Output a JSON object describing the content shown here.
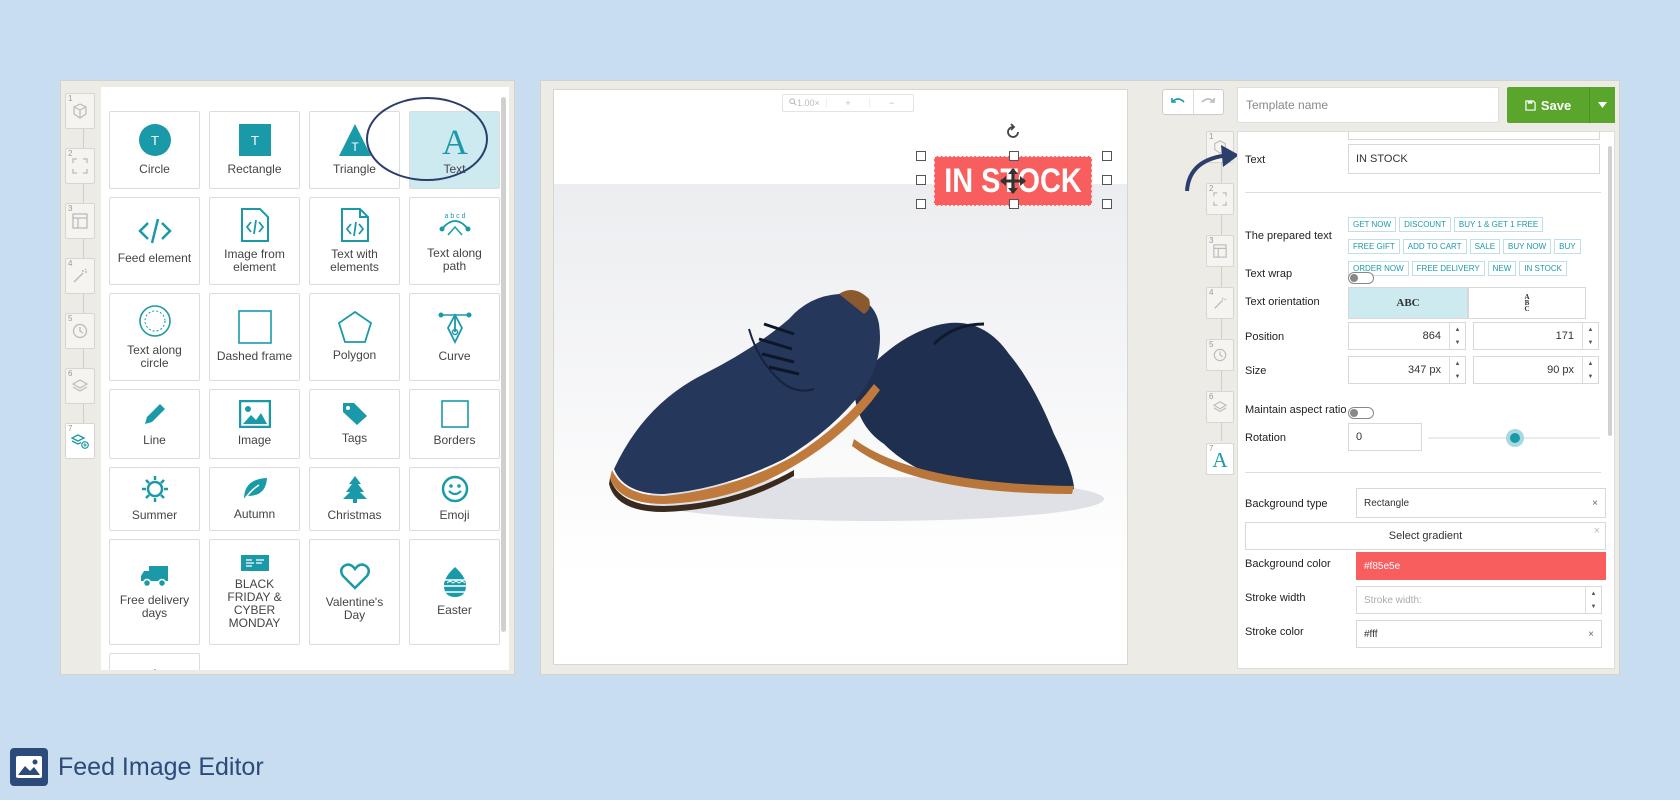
{
  "brand": {
    "title": "Feed Image Editor"
  },
  "elements": [
    {
      "label": "Circle",
      "icon": "circle-icon"
    },
    {
      "label": "Rectangle",
      "icon": "rectangle-icon"
    },
    {
      "label": "Triangle",
      "icon": "triangle-icon"
    },
    {
      "label": "Text",
      "icon": "text-icon"
    },
    {
      "label": "Feed element",
      "icon": "code-icon"
    },
    {
      "label": "Image from element",
      "icon": "image-code-icon"
    },
    {
      "label": "Text with elements",
      "icon": "file-code-icon"
    },
    {
      "label": "Text along path",
      "icon": "text-path-icon"
    },
    {
      "label": "Text along circle",
      "icon": "text-circle-icon"
    },
    {
      "label": "Dashed frame",
      "icon": "frame-icon"
    },
    {
      "label": "Polygon",
      "icon": "polygon-icon"
    },
    {
      "label": "Curve",
      "icon": "curve-icon"
    },
    {
      "label": "Line",
      "icon": "pencil-icon"
    },
    {
      "label": "Image",
      "icon": "image-icon"
    },
    {
      "label": "Tags",
      "icon": "tag-icon"
    },
    {
      "label": "Borders",
      "icon": "border-icon"
    },
    {
      "label": "Summer",
      "icon": "sun-icon"
    },
    {
      "label": "Autumn",
      "icon": "leaf-icon"
    },
    {
      "label": "Christmas",
      "icon": "tree-icon"
    },
    {
      "label": "Emoji",
      "icon": "smile-icon"
    },
    {
      "label": "Free delivery days",
      "icon": "truck-icon"
    },
    {
      "label": "BLACK FRIDAY & CYBER MONDAY",
      "icon": "black-friday-icon"
    },
    {
      "label": "Valentine's Day",
      "icon": "heart-icon"
    },
    {
      "label": "Easter",
      "icon": "egg-icon"
    }
  ],
  "rail_steps": [
    "1",
    "2",
    "3",
    "4",
    "5",
    "6",
    "7"
  ],
  "canvas": {
    "zoom": "1.00×",
    "zoom_in": "+",
    "zoom_out": "−",
    "badge_text": "IN STOCK"
  },
  "template": {
    "placeholder": "Template name",
    "save_label": "Save"
  },
  "props": {
    "text_label": "Text",
    "text_value": "IN STOCK",
    "prepared_label": "The prepared text",
    "prepared_chips": [
      "GET NOW",
      "DISCOUNT",
      "BUY 1 & GET 1 FREE",
      "FREE GIFT",
      "ADD TO CART",
      "SALE",
      "BUY NOW",
      "BUY",
      "ORDER NOW",
      "FREE DELIVERY",
      "NEW",
      "IN STOCK"
    ],
    "wrap_label": "Text wrap",
    "orientation_label": "Text orientation",
    "orientation_h": "ABC",
    "orientation_v": "A B C",
    "position_label": "Position",
    "position_x": "864",
    "position_y": "171",
    "size_label": "Size",
    "size_w": "347 px",
    "size_h": "90 px",
    "aspect_label": "Maintain aspect ratio",
    "rotation_label": "Rotation",
    "rotation_value": "0",
    "bg_type_label": "Background type",
    "bg_type_value": "Rectangle",
    "gradient_label": "Select gradient",
    "bg_color_label": "Background color",
    "bg_color_value": "#f85e5e",
    "stroke_width_label": "Stroke width",
    "stroke_width_placeholder": "Stroke width:",
    "stroke_color_label": "Stroke color",
    "stroke_color_value": "#fff"
  },
  "colors": {
    "accent": "#1a9aa8",
    "save": "#5aa52c",
    "badge": "#f85e5e",
    "brand": "#2c4a7a"
  }
}
